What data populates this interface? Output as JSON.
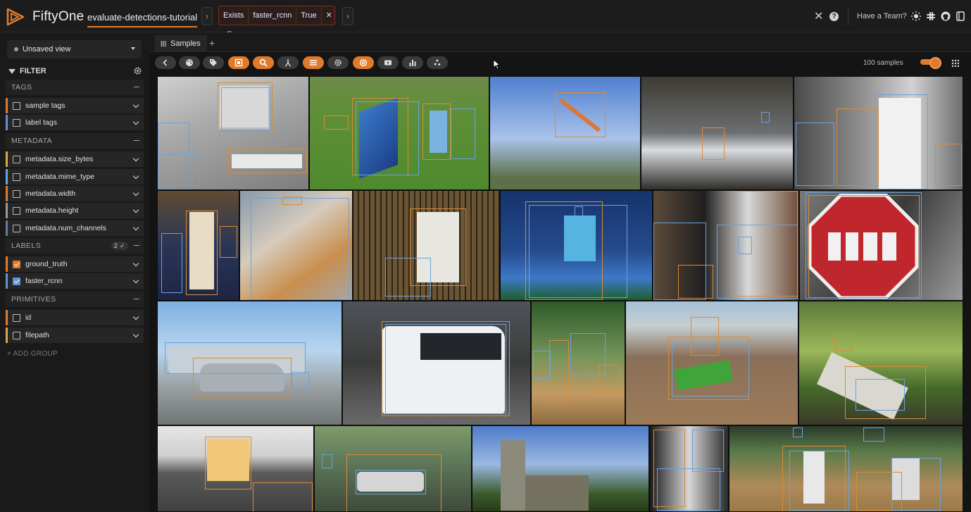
{
  "header": {
    "brand": "FiftyOne",
    "dataset_name": "evaluate-detections-tutorial",
    "filter_pill": {
      "op": "Exists",
      "field": "faster_rcnn",
      "value": "True"
    },
    "team_label": "Have a Team?"
  },
  "sidebar": {
    "view_label": "Unsaved view",
    "filter_title": "FILTER",
    "groups": {
      "tags": "TAGS",
      "metadata": "METADATA",
      "labels": "LABELS",
      "labels_badge": "2 ✓",
      "primitives": "PRIMITIVES"
    },
    "fields": {
      "sample_tags": "sample tags",
      "label_tags": "label tags",
      "size_bytes": "metadata.size_bytes",
      "mime_type": "metadata.mime_type",
      "width": "metadata.width",
      "height": "metadata.height",
      "num_channels": "metadata.num_channels",
      "ground_truth": "ground_truth",
      "faster_rcnn": "faster_rcnn",
      "id": "id",
      "filepath": "filepath"
    },
    "add_group": "+ ADD GROUP"
  },
  "main": {
    "tab_label": "Samples",
    "sample_count": "100 samples"
  },
  "colors": {
    "accent": "#e07b2c",
    "ground_truth": "#e07b2c",
    "faster_rcnn": "#5b95d6"
  }
}
